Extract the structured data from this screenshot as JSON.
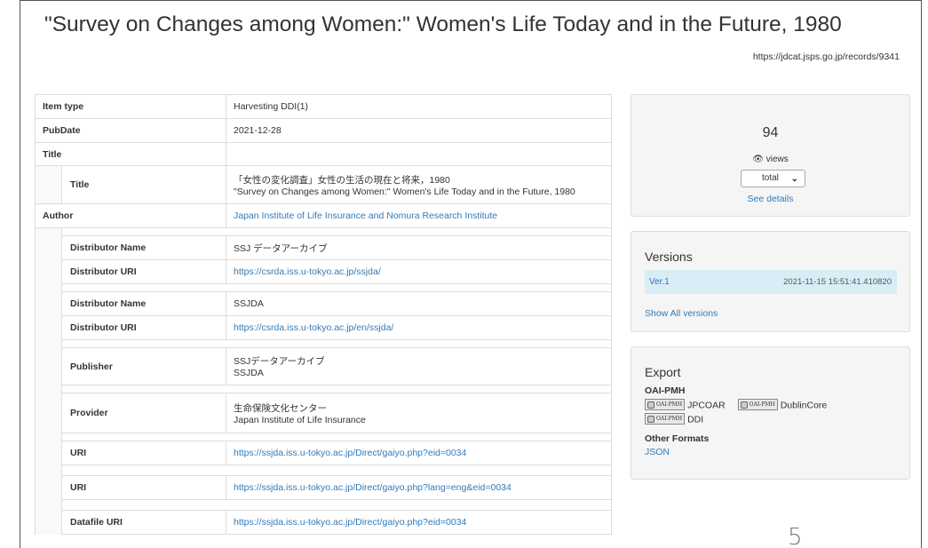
{
  "page": {
    "title": "\"Survey on Changes among Women:\" Women's Life Today and in the Future, 1980",
    "record_url": "https://jdcat.jsps.go.jp/records/9341",
    "page_number": "5"
  },
  "metadata": {
    "item_type": {
      "label": "Item type",
      "value": "Harvesting DDI(1)"
    },
    "pubdate": {
      "label": "PubDate",
      "value": "2021-12-28"
    },
    "title_group": {
      "label": "Title"
    },
    "title": {
      "label": "Title",
      "value_ja": "「女性の変化調査」女性の生活の現在と将来，1980",
      "value_en": "\"Survey on Changes among Women:\" Women's Life Today and in the Future, 1980"
    },
    "author": {
      "label": "Author",
      "value": "Japan Institute of Life Insurance and Nomura Research Institute"
    },
    "distributor_1": {
      "name_label": "Distributor Name",
      "name": "SSJ データアーカイブ",
      "uri_label": "Distributor URI",
      "uri": "https://csrda.iss.u-tokyo.ac.jp/ssjda/"
    },
    "distributor_2": {
      "name_label": "Distributor Name",
      "name": "SSJDA",
      "uri_label": "Distributor URI",
      "uri": "https://csrda.iss.u-tokyo.ac.jp/en/ssjda/"
    },
    "publisher": {
      "label": "Publisher",
      "value_1": "SSJデータアーカイブ",
      "value_2": "SSJDA"
    },
    "provider": {
      "label": "Provider",
      "value_1": "生命保険文化センター",
      "value_2": "Japan Institute of Life Insurance"
    },
    "uri_1": {
      "label": "URI",
      "value": "https://ssjda.iss.u-tokyo.ac.jp/Direct/gaiyo.php?eid=0034"
    },
    "uri_2": {
      "label": "URI",
      "value": "https://ssjda.iss.u-tokyo.ac.jp/Direct/gaiyo.php?lang=eng&eid=0034"
    },
    "datafile_uri": {
      "label": "Datafile URI",
      "value": "https://ssjda.iss.u-tokyo.ac.jp/Direct/gaiyo.php?eid=0034"
    }
  },
  "views_panel": {
    "count": "94",
    "label": "views",
    "icon": "eye-icon",
    "select_value": "total",
    "see_details": "See details"
  },
  "versions_panel": {
    "title": "Versions",
    "items": [
      {
        "label": "Ver.1",
        "timestamp": "2021-11-15 15:51:41.410820"
      }
    ],
    "show_all": "Show All versions",
    "highlight_color": "#d9edf7"
  },
  "export_panel": {
    "title": "Export",
    "oai_label": "OAI-PMH",
    "badge_text": "OAI-PMH",
    "formats": [
      "JPCOAR",
      "DublinCore",
      "DDI"
    ],
    "other_label": "Other Formats",
    "json": "JSON"
  },
  "colors": {
    "link": "#337ab7",
    "panel_bg": "#f5f5f5"
  }
}
